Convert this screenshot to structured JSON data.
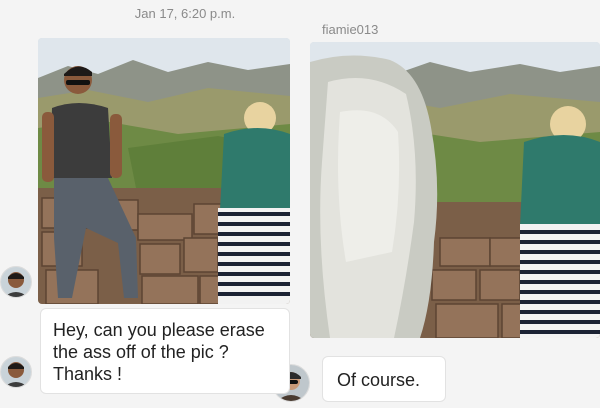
{
  "conversation": {
    "timestamp": "Jan 17, 6:20 p.m.",
    "reply_sender": "fiamie013"
  },
  "messages": [
    {
      "sender": "requester",
      "lines": [
        "Hey, can you please erase",
        "the ass off of the pic ?",
        "Thanks !"
      ]
    },
    {
      "sender": "fiamie013",
      "lines": [
        "Of course."
      ]
    }
  ],
  "colors": {
    "page_background": "#f4f4f4",
    "bubble_background": "#ffffff",
    "meta_text": "#8a8a8a"
  }
}
